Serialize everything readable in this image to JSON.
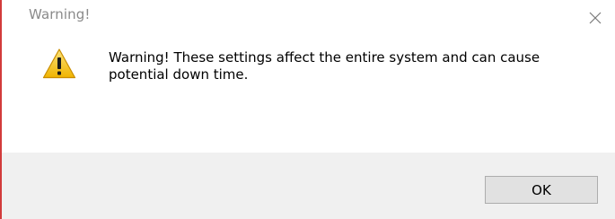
{
  "dialog": {
    "title": "Warning!",
    "message": "Warning! These settings affect the entire system and can cause potential down time.",
    "icon": "warning-triangle-icon",
    "ok_label": "OK",
    "close_icon": "close-icon"
  },
  "colors": {
    "footer_background": "#f0f0f0",
    "title_text": "#8a8a8a",
    "warning_yellow": "#f2c21b",
    "button_background": "#e1e1e1",
    "button_border": "#adadad"
  }
}
